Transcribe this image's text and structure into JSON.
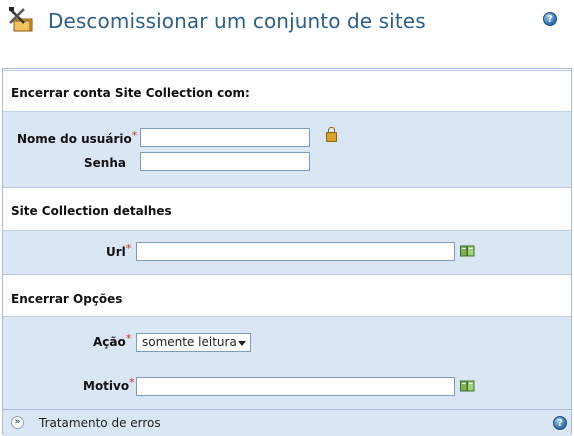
{
  "page": {
    "title": "Descomissionar um conjunto de sites",
    "title_icon": "decommission-tools-icon",
    "help_icon": "help-icon"
  },
  "sections": {
    "credentials": {
      "heading": "Encerrar conta Site Collection com:",
      "username_label": "Nome do usuário",
      "username_value": "",
      "password_label": "Senha",
      "password_value": ""
    },
    "details": {
      "heading": "Site Collection detalhes",
      "url_label": "Url",
      "url_value": ""
    },
    "options": {
      "heading": "Encerrar Opções",
      "action_label": "Ação",
      "action_selected": "somente leitura",
      "reason_label": "Motivo",
      "reason_value": ""
    }
  },
  "footer": {
    "label": "Tratamento de erros"
  },
  "required_marker": "*",
  "colors": {
    "title": "#2c5f8a",
    "section_body": "#dbe6f5",
    "required": "#d03020",
    "border": "#a9bdd7"
  }
}
